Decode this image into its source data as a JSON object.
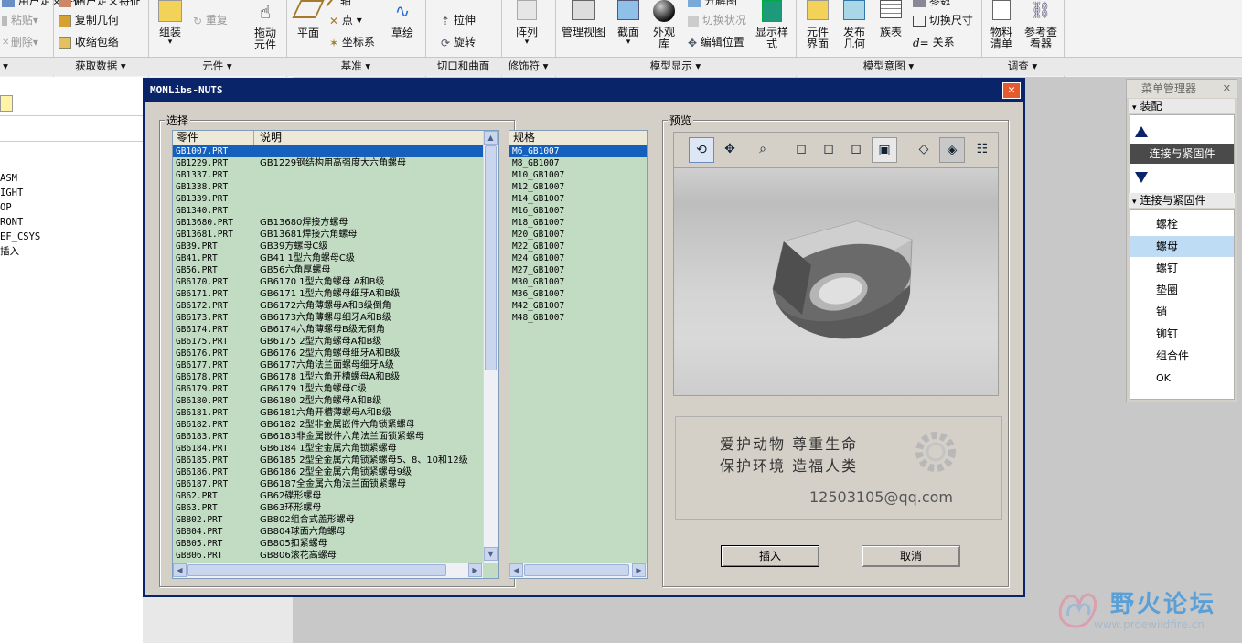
{
  "ribbon": {
    "left_small": [
      {
        "label": "用户定义特征",
        "disabled": false
      },
      {
        "label": "粘贴",
        "disabled": true
      },
      {
        "label": "删除",
        "disabled": true
      }
    ],
    "copy_small": [
      {
        "label": "复制几何"
      },
      {
        "label": "收缩包络"
      }
    ],
    "assemble": "组装",
    "redo": "重复",
    "drag": "拖动元件",
    "plane": "平面",
    "point": "点",
    "csys": "坐标系",
    "axis": "轴",
    "sketch": "草绘",
    "extrude": "拉伸",
    "revolve": "旋转",
    "pattern": "阵列",
    "manage_view": "管理视图",
    "section": "截面",
    "appearance": "外观库",
    "toggle_status": "切换状况",
    "edit_position": "编辑位置",
    "display_style": "显示样式",
    "comp_interface": "元件界面",
    "publish_geom": "发布几何",
    "family_table": "族表",
    "switch_dims": "切换尺寸",
    "relations": "关系",
    "bom": "物料清单",
    "ref_viewer": "参考查看器",
    "groups": [
      "获取数据",
      "元件",
      "基准",
      "切口和曲面",
      "修饰符",
      "模型显示",
      "模型意图",
      "调查"
    ]
  },
  "tree": {
    "items": [
      "ASM",
      "IGHT",
      "OP",
      "RONT",
      "EF_CSYS",
      "插入"
    ]
  },
  "dialog": {
    "title": "MONLibs-NUTS",
    "select_label": "选择",
    "col_part": "零件",
    "col_desc": "说明",
    "parts": [
      {
        "part": "GB1007.PRT",
        "desc": ""
      },
      {
        "part": "GB1229.PRT",
        "desc": "GB1229钢结构用高强度大六角螺母"
      },
      {
        "part": "GB1337.PRT",
        "desc": ""
      },
      {
        "part": "GB1338.PRT",
        "desc": ""
      },
      {
        "part": "GB1339.PRT",
        "desc": ""
      },
      {
        "part": "GB1340.PRT",
        "desc": ""
      },
      {
        "part": "GB13680.PRT",
        "desc": "GB13680焊接方螺母"
      },
      {
        "part": "GB13681.PRT",
        "desc": "GB13681焊接六角螺母"
      },
      {
        "part": "GB39.PRT",
        "desc": "GB39方螺母C级"
      },
      {
        "part": "GB41.PRT",
        "desc": "GB41  1型六角螺母C级"
      },
      {
        "part": "GB56.PRT",
        "desc": "GB56六角厚螺母"
      },
      {
        "part": "GB6170.PRT",
        "desc": "GB6170  1型六角螺母  A和B级"
      },
      {
        "part": "GB6171.PRT",
        "desc": "GB6171  1型六角螺母细牙A和B级"
      },
      {
        "part": "GB6172.PRT",
        "desc": "GB6172六角薄螺母A和B级倒角"
      },
      {
        "part": "GB6173.PRT",
        "desc": "GB6173六角薄螺母细牙A和B级"
      },
      {
        "part": "GB6174.PRT",
        "desc": "GB6174六角薄螺母B级无倒角"
      },
      {
        "part": "GB6175.PRT",
        "desc": "GB6175  2型六角螺母A和B级"
      },
      {
        "part": "GB6176.PRT",
        "desc": "GB6176  2型六角螺母细牙A和B级"
      },
      {
        "part": "GB6177.PRT",
        "desc": "GB6177六角法兰面螺母细牙A级"
      },
      {
        "part": "GB6178.PRT",
        "desc": "GB6178  1型六角开槽螺母A和B级"
      },
      {
        "part": "GB6179.PRT",
        "desc": "GB6179  1型六角螺母C级"
      },
      {
        "part": "GB6180.PRT",
        "desc": "GB6180  2型六角螺母A和B级"
      },
      {
        "part": "GB6181.PRT",
        "desc": "GB6181六角开槽薄螺母A和B级"
      },
      {
        "part": "GB6182.PRT",
        "desc": "GB6182  2型非金属嵌件六角锁紧螺母"
      },
      {
        "part": "GB6183.PRT",
        "desc": "GB6183非金属嵌件六角法兰面锁紧螺母"
      },
      {
        "part": "GB6184.PRT",
        "desc": "GB6184  1型全金属六角锁紧螺母"
      },
      {
        "part": "GB6185.PRT",
        "desc": "GB6185  2型全金属六角锁紧螺母5、8、10和12级"
      },
      {
        "part": "GB6186.PRT",
        "desc": "GB6186  2型全金属六角锁紧螺母9级"
      },
      {
        "part": "GB6187.PRT",
        "desc": "GB6187全金属六角法兰面锁紧螺母"
      },
      {
        "part": "GB62.PRT",
        "desc": "GB62碟形螺母"
      },
      {
        "part": "GB63.PRT",
        "desc": "GB63环形螺母"
      },
      {
        "part": "GB802.PRT",
        "desc": "GB802组合式盖形螺母"
      },
      {
        "part": "GB804.PRT",
        "desc": "GB804球面六角螺母"
      },
      {
        "part": "GB805.PRT",
        "desc": "GB805扣紧螺母"
      },
      {
        "part": "GB806.PRT",
        "desc": "GB806滚花高螺母"
      }
    ],
    "spec_label": "规格",
    "specs": [
      "M6_GB1007",
      "M8_GB1007",
      "M10_GB1007",
      "M12_GB1007",
      "M14_GB1007",
      "M16_GB1007",
      "M18_GB1007",
      "M20_GB1007",
      "M22_GB1007",
      "M24_GB1007",
      "M27_GB1007",
      "M30_GB1007",
      "M36_GB1007",
      "M42_GB1007",
      "M48_GB1007"
    ],
    "preview_label": "预览",
    "slogan_line1": "爱护动物  尊重生命",
    "slogan_line2": "保护环境  造福人类",
    "email": "12503105@qq.com",
    "insert_button": "插入",
    "cancel_button": "取消"
  },
  "menu_manager": {
    "title": "菜单管理器",
    "section_assembly": "装配",
    "active_item": "连接与紧固件",
    "section_fasteners": "连接与紧固件",
    "items": [
      "螺栓",
      "螺母",
      "螺钉",
      "垫圈",
      "销",
      "铆钉",
      "组合件",
      "OK"
    ]
  },
  "watermark": {
    "forum_name": "野火论坛",
    "url": "www.proewildfire.cn"
  }
}
